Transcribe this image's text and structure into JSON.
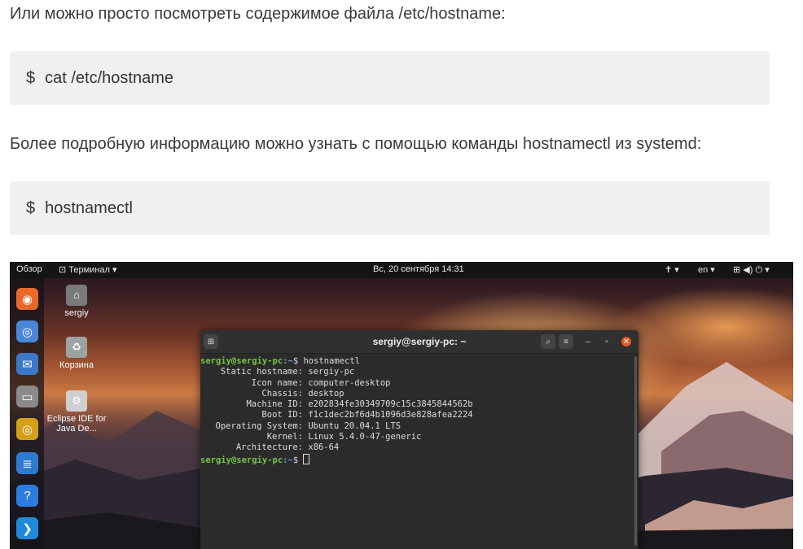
{
  "article": {
    "para1": "Или можно просто посмотреть содержимое файла /etc/hostname:",
    "code1": {
      "prompt": "$",
      "command": "cat /etc/hostname"
    },
    "para2": "Более подробную информацию можно узнать с помощью команды hostnamectl из systemd:",
    "code2": {
      "prompt": "$",
      "command": "hostnamectl"
    }
  },
  "screenshot": {
    "topbar": {
      "activities": "Обзор",
      "app_menu": "Терминал ▾",
      "clock": "Вс, 20 сентября  14:31",
      "accessibility": "✝ ▾",
      "language": "en ▾",
      "system": "⊞ ◀) ⏻ ▾"
    },
    "dock": [
      {
        "name": "firefox",
        "glyph": "◉",
        "color": "#e8692a"
      },
      {
        "name": "chromium",
        "glyph": "◎",
        "color": "#4a86d8"
      },
      {
        "name": "thunderbird",
        "glyph": "✉",
        "color": "#3c78c8"
      },
      {
        "name": "files",
        "glyph": "▭",
        "color": "#8a8a8a"
      },
      {
        "name": "rhythmbox",
        "glyph": "◎",
        "color": "#d4a017"
      },
      {
        "name": "writer",
        "glyph": "≣",
        "color": "#2f7ad1"
      },
      {
        "name": "help",
        "glyph": "?",
        "color": "#2c7de0"
      },
      {
        "name": "vscode",
        "glyph": "❯",
        "color": "#1f8ad9"
      }
    ],
    "desktop_icons": [
      {
        "label": "sergiy",
        "glyph": "⌂",
        "color": "#7a7a7a"
      },
      {
        "label": "Корзина",
        "glyph": "♻",
        "color": "#9aa3a0"
      },
      {
        "label": "Eclipse IDE for Java De...",
        "glyph": "⚙",
        "color": "#cfcfcf"
      }
    ],
    "terminal": {
      "title": "sergiy@sergiy-pc: ~",
      "user_host": "sergiy@sergiy-pc",
      "path": ":~",
      "dollar": "$",
      "command": " hostnamectl",
      "rows": [
        {
          "key": "Static hostname:",
          "value": "sergiy-pc"
        },
        {
          "key": "Icon name:",
          "value": "computer-desktop"
        },
        {
          "key": "Chassis:",
          "value": "desktop"
        },
        {
          "key": "Machine ID:",
          "value": "e202834fe30349709c15c3845844562b"
        },
        {
          "key": "Boot ID:",
          "value": "f1c1dec2bf6d4b1096d3e828afea2224"
        },
        {
          "key": "Operating System:",
          "value": "Ubuntu 20.04.1 LTS"
        },
        {
          "key": "Kernel:",
          "value": "Linux 5.4.0-47-generic"
        },
        {
          "key": "Architecture:",
          "value": "x86-64"
        }
      ]
    }
  }
}
